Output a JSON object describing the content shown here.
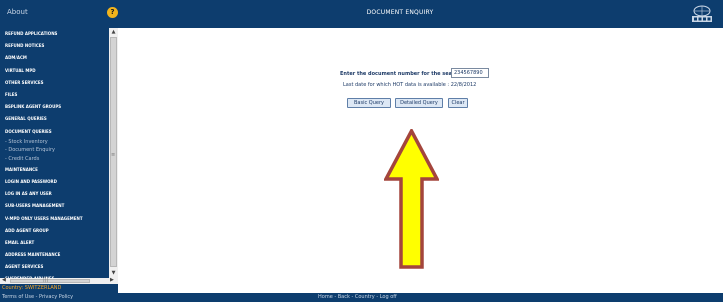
{
  "header": {
    "about_label": "About",
    "help_icon_glyph": "?",
    "title": "DOCUMENT ENQUIRY",
    "logo_icon": "iata-logo-icon",
    "bar_color": "#0d3d6e"
  },
  "sidebar": {
    "items": [
      {
        "label": "REFUND APPLICATIONS",
        "type": "section"
      },
      {
        "label": "REFUND NOTICES",
        "type": "section"
      },
      {
        "label": "ADM/ACM",
        "type": "section"
      },
      {
        "label": "VIRTUAL MPD",
        "type": "section"
      },
      {
        "label": "OTHER SERVICES",
        "type": "section"
      },
      {
        "label": "FILES",
        "type": "section"
      },
      {
        "label": "BSPLINK AGENT GROUPS",
        "type": "section"
      },
      {
        "label": "GENERAL QUERIES",
        "type": "section"
      },
      {
        "label": "DOCUMENT QUERIES",
        "type": "section"
      },
      {
        "label": "- Stock Inventory",
        "type": "sub"
      },
      {
        "label": "- Document Enquiry",
        "type": "sub"
      },
      {
        "label": "- Credit Cards",
        "type": "sub"
      },
      {
        "label": "MAINTENANCE",
        "type": "section"
      },
      {
        "label": "LOGIN AND PASSWORD",
        "type": "section"
      },
      {
        "label": "LOG IN AS ANY USER",
        "type": "section"
      },
      {
        "label": "SUB-USERS MANAGEMENT",
        "type": "section"
      },
      {
        "label": "V-MPD ONLY USERS MANAGEMENT",
        "type": "section"
      },
      {
        "label": "ADD AGENT GROUP",
        "type": "section"
      },
      {
        "label": "EMAIL ALERT",
        "type": "section"
      },
      {
        "label": "ADDRESS MAINTENANCE",
        "type": "section"
      },
      {
        "label": "AGENT SERVICES",
        "type": "section"
      },
      {
        "label": "SUSPENDED AIRLINES",
        "type": "section"
      }
    ],
    "hscroll_grip": "|||",
    "vscroll_grip": "≡",
    "country_label": "Country: SWITZERLAND"
  },
  "main": {
    "prompt_label": "Enter the document number for the search :",
    "document_number_value": "234567890",
    "last_date_text": "Last date for which HOT data is available : 22/8/2012",
    "buttons": {
      "basic_query": "Basic Query",
      "detailed_query": "Detailed Query",
      "clear": "Clear"
    },
    "annotation_arrow_colors": {
      "fill": "#ffff00",
      "outline": "#a4453c"
    }
  },
  "footer": {
    "terms_text": "Terms of Use - Privacy Policy",
    "nav_text": "Home - Back - Country - Log off"
  }
}
